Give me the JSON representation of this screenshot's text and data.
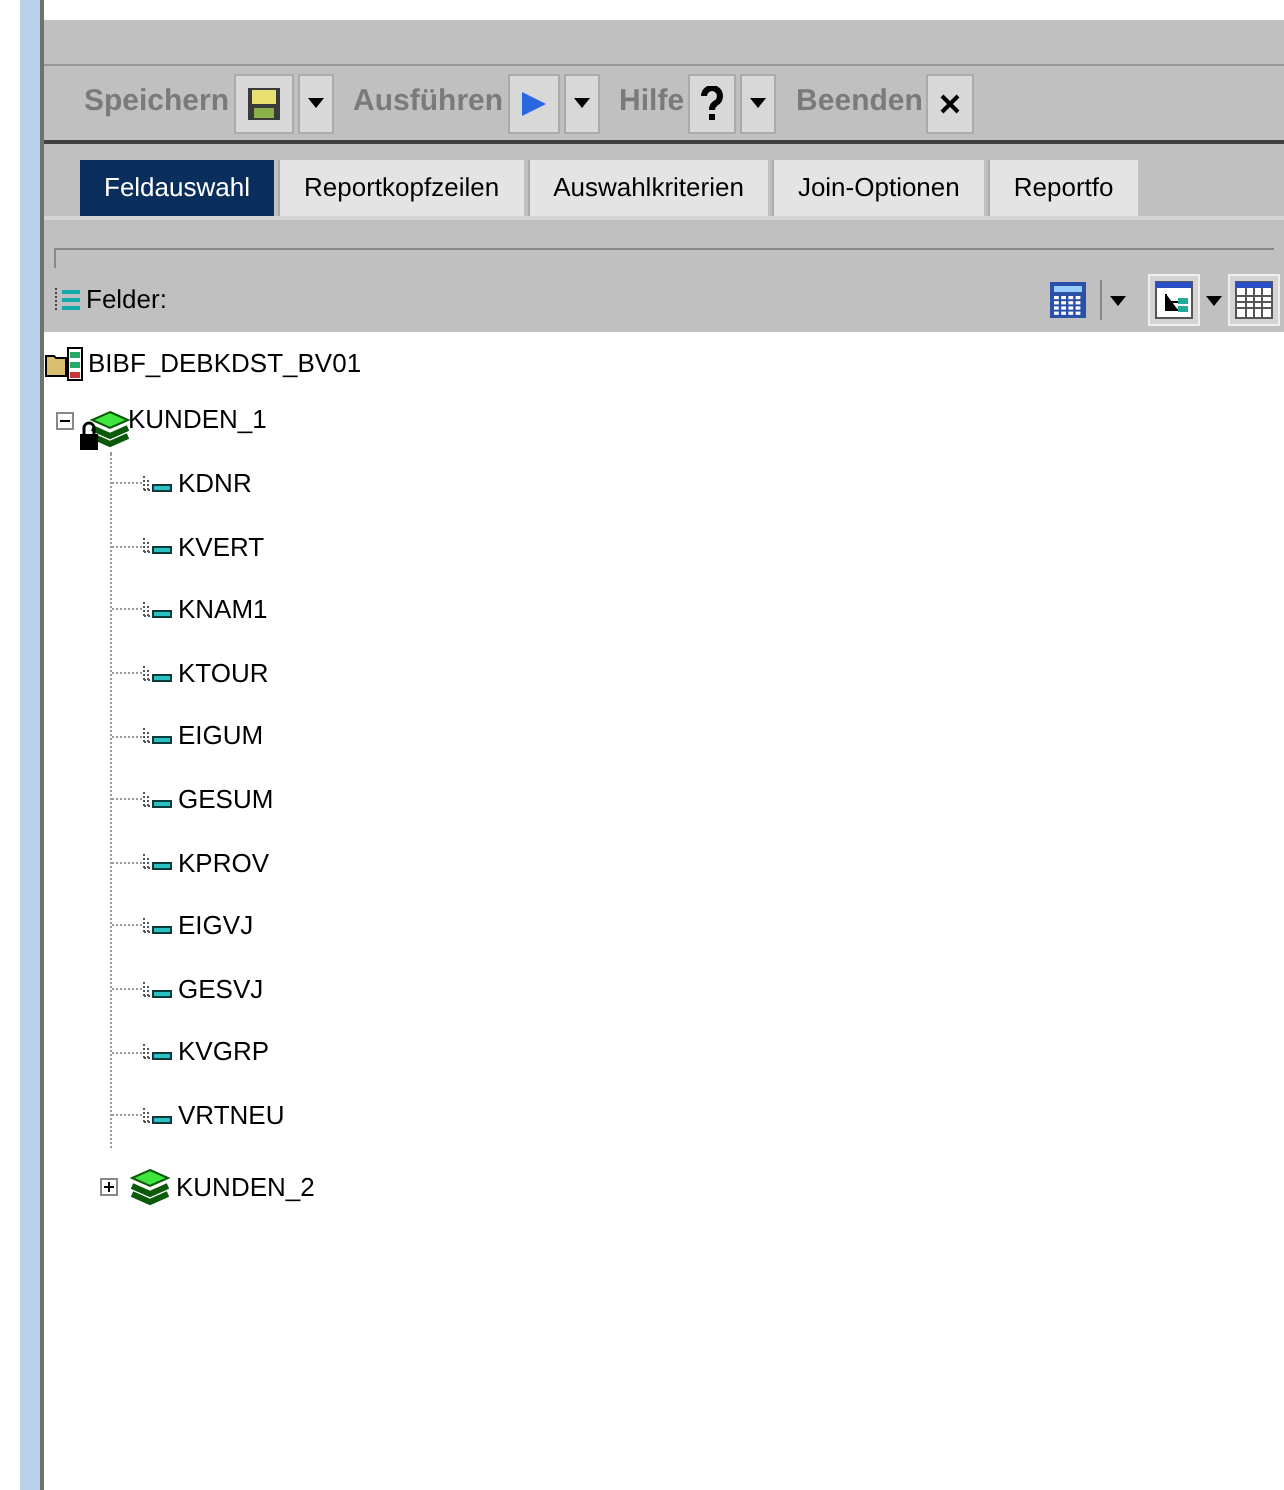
{
  "toolbar": [
    {
      "label": "Speichern",
      "kind": "save",
      "dropdown": true
    },
    {
      "label": "Ausführen",
      "kind": "run",
      "dropdown": true
    },
    {
      "label": "Hilfe",
      "kind": "help",
      "dropdown": true
    },
    {
      "label": "Beenden",
      "kind": "close",
      "dropdown": false
    }
  ],
  "tabs": [
    {
      "label": "Feldauswahl",
      "selected": true
    },
    {
      "label": "Reportkopfzeilen",
      "selected": false
    },
    {
      "label": "Auswahlkriterien",
      "selected": false
    },
    {
      "label": "Join-Optionen",
      "selected": false
    },
    {
      "label": "Reportfo",
      "selected": false
    }
  ],
  "fields_panel": {
    "title": "Felder:"
  },
  "tree": {
    "label": "BIBF_DEBKDST_BV01",
    "children": [
      {
        "label": "KUNDEN_1",
        "locked": true,
        "expanded": true,
        "children": [
          {
            "label": "KDNR"
          },
          {
            "label": "KVERT"
          },
          {
            "label": "KNAM1"
          },
          {
            "label": "KTOUR"
          },
          {
            "label": "EIGUM"
          },
          {
            "label": "GESUM"
          },
          {
            "label": "KPROV"
          },
          {
            "label": "EIGVJ"
          },
          {
            "label": "GESVJ"
          },
          {
            "label": "KVGRP"
          },
          {
            "label": "VRTNEU"
          }
        ]
      },
      {
        "label": "KUNDEN_2",
        "locked": false,
        "expanded": false
      }
    ]
  }
}
